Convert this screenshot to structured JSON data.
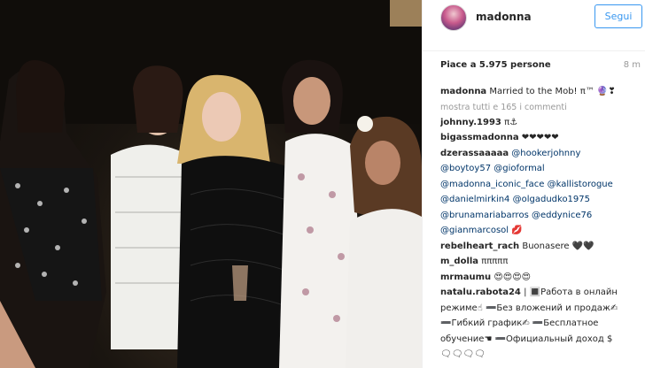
{
  "post": {
    "photo_alt": "",
    "author": {
      "username": "madonna",
      "follow_label": "Segui"
    },
    "likes_text": "Piace a 5.975 persone",
    "time_text": "8 m",
    "caption": {
      "username": "madonna",
      "text": "Married to the Mob! π™ 🔮❣"
    },
    "view_all_comments": "mostra tutti e 165 i commenti",
    "comments": [
      {
        "username": "johnny.1993",
        "text": "π⚓"
      },
      {
        "username": "bigassmadonna",
        "text": "❤❤❤❤❤"
      },
      {
        "username": "dzerassaaaaa",
        "lines": [
          "@hookerjohnny",
          "@boytoy57 @gioformal",
          "@madonna_iconic_face @kallistorogue",
          "@danielmirkin4 @olgadudko1975",
          "@brunamariabarros @eddynice76",
          "@gianmarcosol 💋"
        ]
      },
      {
        "username": "rebelheart_rach",
        "text": "Buonasere 🖤🖤"
      },
      {
        "username": "m_dolla",
        "text": "πππππ"
      },
      {
        "username": "mrmaumu",
        "text": "😍😍😍😍"
      },
      {
        "username": "natalu.rabota24",
        "lines": [
          "| 🔳Работа в онлайн",
          "режиме☝ ➖Без вложений и продаж✍",
          "➖Гибкий график✍ ➖Бесплатное",
          "обучение☚ ➖Официальный доход $",
          "🗨🗨🗨🗨"
        ]
      }
    ]
  },
  "colors": {
    "accent": "#3897f0",
    "text": "#262626",
    "muted": "#999999",
    "mention": "#003569"
  },
  "icons": [
    "avatar"
  ]
}
